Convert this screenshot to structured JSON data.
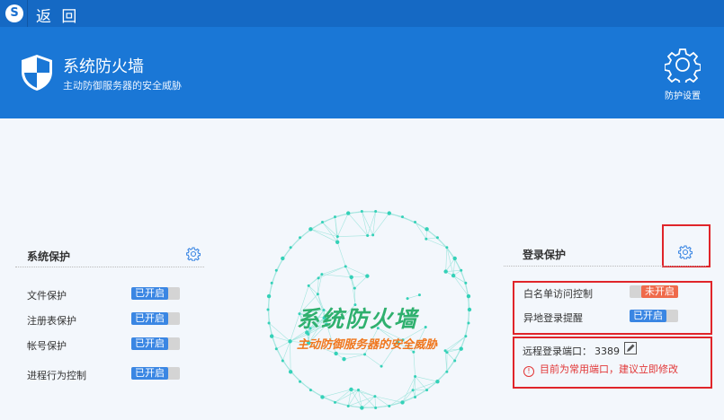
{
  "topbar": {
    "logo": "S",
    "back_label": "返 回"
  },
  "header": {
    "title": "系统防火墙",
    "subtitle": "主动防御服务器的安全威胁",
    "settings_label": "防护设置"
  },
  "center": {
    "title": "系统防火墙",
    "subtitle": "主动防御服务器的安全威胁"
  },
  "system_protection": {
    "title": "系统保护",
    "items": [
      {
        "label": "文件保护",
        "status": "已开启"
      },
      {
        "label": "注册表保护",
        "status": "已开启"
      },
      {
        "label": "帐号保护",
        "status": "已开启"
      },
      {
        "label": "进程行为控制",
        "status": "已开启"
      }
    ]
  },
  "login_protection": {
    "title": "登录保护",
    "items": [
      {
        "label": "白名单访问控制",
        "status": "未开启"
      },
      {
        "label": "异地登录提醒",
        "status": "已开启"
      }
    ],
    "port_label": "远程登录端口：",
    "port_value": "3389",
    "warning": "目前为常用端口，建议立即修改"
  },
  "colors": {
    "header": "#1a77d6",
    "on": "#3a86e3",
    "off": "#ef6a4b",
    "highlight": "#e0252a",
    "center_title": "#2fb06e",
    "center_sub": "#f0771e"
  }
}
